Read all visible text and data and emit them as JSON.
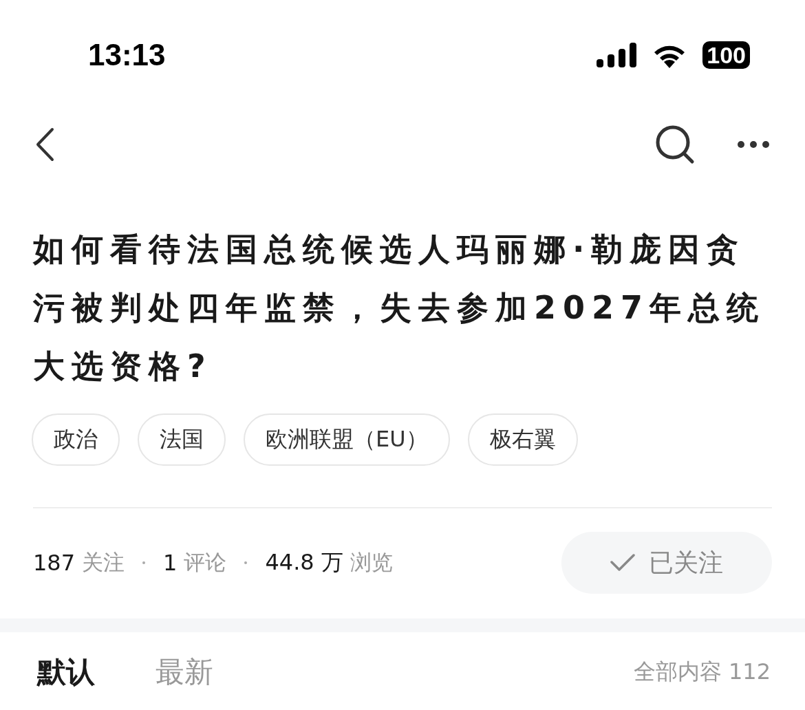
{
  "status_bar": {
    "time": "13:13",
    "battery": "100"
  },
  "question": {
    "title": "如何看待法国总统候选人玛丽娜·勒庞因贪污被判处四年监禁，失去参加2027年总统大选资格?"
  },
  "tags": [
    "政治",
    "法国",
    "欧洲联盟（EU）",
    "极右翼"
  ],
  "stats": [
    {
      "count": "187",
      "noun": "关注"
    },
    {
      "count": "1",
      "noun": "评论"
    },
    {
      "count": "44.8 万",
      "noun": "浏览"
    }
  ],
  "follow_button": {
    "label": "已关注",
    "followed": true
  },
  "sort_tabs": [
    {
      "label": "默认",
      "selected": true
    },
    {
      "label": "最新",
      "selected": false
    }
  ],
  "total": "全部内容 112"
}
